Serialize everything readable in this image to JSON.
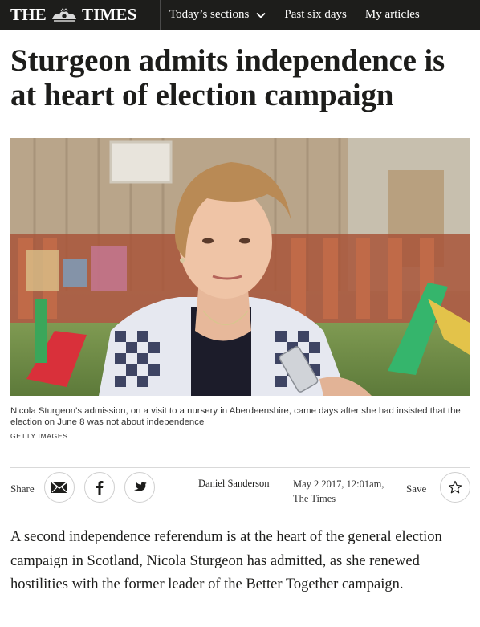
{
  "nav": {
    "logo_left": "THE",
    "logo_right": "TIMES",
    "sections": "Today’s sections",
    "past": "Past six days",
    "articles": "My articles"
  },
  "article": {
    "headline": "Sturgeon admits independence is at heart of election campaign",
    "caption": "Nicola Sturgeon’s admission, on a visit to a nursery in Aberdeenshire, came days after she had insisted that the election on June 8 was not about independence",
    "credit": "GETTY IMAGES",
    "share_label": "Share",
    "author": "Daniel Sanderson",
    "date": "May 2 2017, 12:01am,",
    "publication": "The Times",
    "save_label": "Save",
    "lead": "A second independence referendum is at the heart of the general election campaign in Scotland, Nicola Sturgeon has admitted, as she renewed hostilities with the former leader of the Better Together campaign."
  },
  "icons": {
    "crest": "royal-crest-icon",
    "chevron": "chevron-down-icon",
    "email": "email-icon",
    "facebook": "facebook-icon",
    "twitter": "twitter-icon",
    "star": "star-icon"
  },
  "colors": {
    "nav_background": "#1d1d1b",
    "text": "#1d1d1b",
    "divider": "#d9d9d9"
  }
}
